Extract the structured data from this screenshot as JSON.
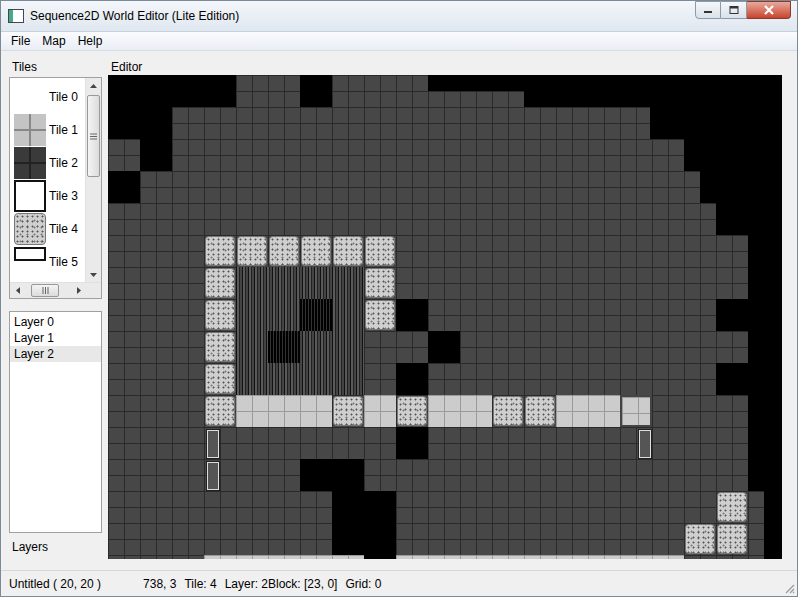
{
  "window": {
    "title": "Sequence2D World Editor (Lite Edition)"
  },
  "menu": [
    "File",
    "Map",
    "Help"
  ],
  "tiles": {
    "label": "Tiles",
    "items": [
      {
        "label": "Tile 0",
        "kind": "empty"
      },
      {
        "label": "Tile 1",
        "kind": "light"
      },
      {
        "label": "Tile 2",
        "kind": "dark"
      },
      {
        "label": "Tile 3",
        "kind": "white"
      },
      {
        "label": "Tile 4",
        "kind": "stone"
      },
      {
        "label": "Tile 5",
        "kind": "outline"
      }
    ]
  },
  "layers": {
    "label": "Layers",
    "items": [
      {
        "label": "Layer 0",
        "selected": false
      },
      {
        "label": "Layer 1",
        "selected": false
      },
      {
        "label": "Layer 2",
        "selected": true
      }
    ]
  },
  "editor": {
    "label": "Editor"
  },
  "status_bar": {
    "document": "Untitled ( 20, 20 )",
    "fields": [
      "738, 3",
      "Tile: 4",
      "Layer: 2Block: [23, 0]",
      "Grid: 0"
    ]
  }
}
